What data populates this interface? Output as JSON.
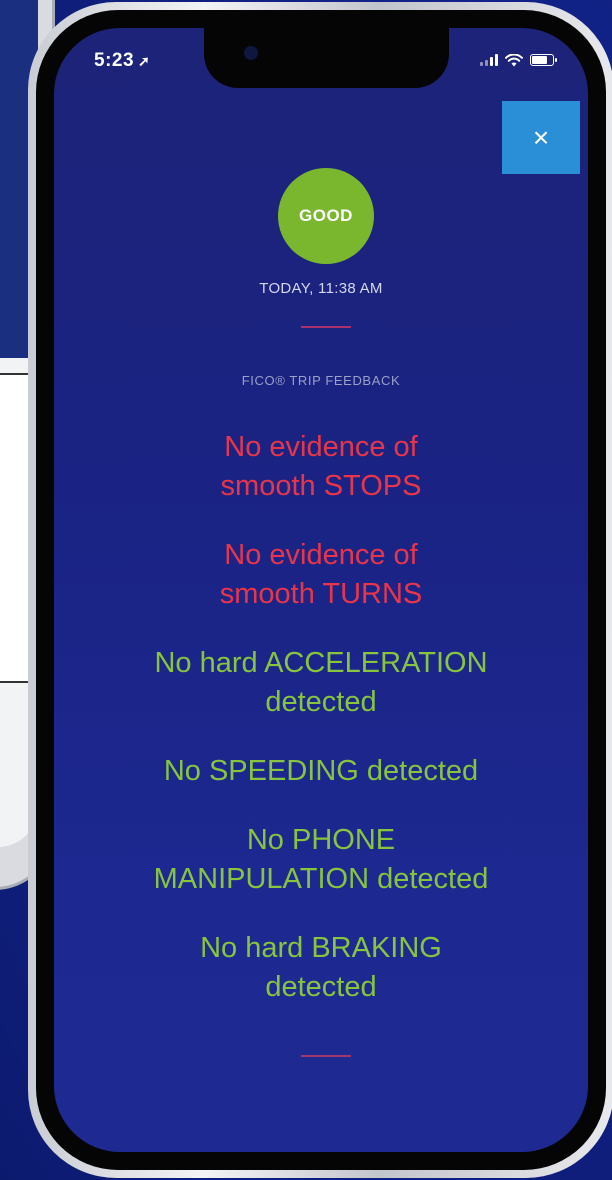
{
  "status_bar": {
    "time": "5:23",
    "location_icon": "location-arrow-icon"
  },
  "close_button": {
    "label": "×",
    "icon": "close-icon"
  },
  "trip": {
    "rating": "GOOD",
    "rating_color": "#7ab72f",
    "timestamp": "TODAY, 11:38 AM",
    "feedback_heading": "FICO® TRIP FEEDBACK"
  },
  "colors": {
    "negative": "#e8354a",
    "positive": "#86c53d",
    "accent": "#2a8fd6",
    "divider": "#a8326a"
  },
  "feedback_items": [
    {
      "lines": [
        "No evidence of",
        "smooth STOPS"
      ],
      "status": "negative"
    },
    {
      "lines": [
        "No evidence of",
        "smooth TURNS"
      ],
      "status": "negative"
    },
    {
      "lines": [
        "No hard ACCELERATION",
        "detected"
      ],
      "status": "positive"
    },
    {
      "lines": [
        "No SPEEDING detected"
      ],
      "status": "positive"
    },
    {
      "lines": [
        "No PHONE",
        "MANIPULATION detected"
      ],
      "status": "positive"
    },
    {
      "lines": [
        "No hard BRAKING",
        "detected"
      ],
      "status": "positive"
    }
  ]
}
